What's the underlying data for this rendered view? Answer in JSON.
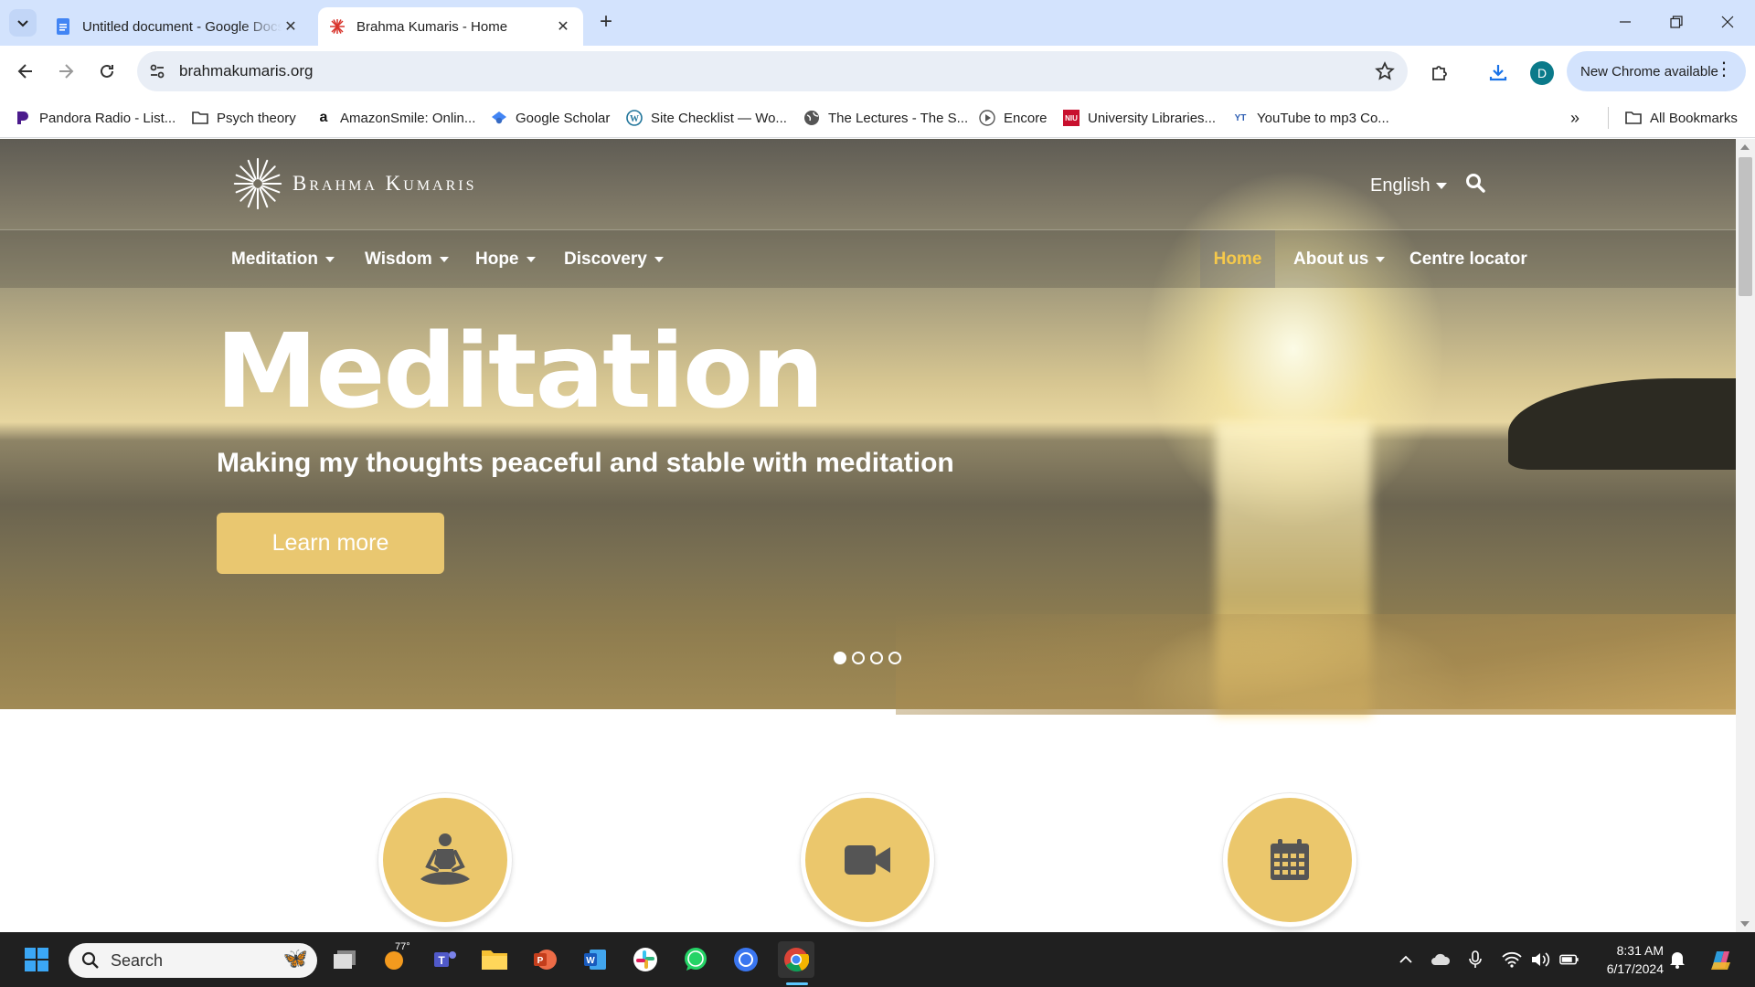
{
  "browser": {
    "tabs": [
      {
        "title": "Untitled document - Google Docs"
      },
      {
        "title": "Brahma Kumaris - Home"
      }
    ],
    "url": "brahmakumaris.org",
    "profile_initial": "D",
    "update_label": "New Chrome available"
  },
  "bookmarks": [
    {
      "label": "Pandora Radio - List..."
    },
    {
      "label": "Psych theory"
    },
    {
      "label": "AmazonSmile: Onlin..."
    },
    {
      "label": "Google Scholar"
    },
    {
      "label": "Site Checklist — Wo..."
    },
    {
      "label": "The Lectures - The S..."
    },
    {
      "label": "Encore"
    },
    {
      "label": "University Libraries..."
    },
    {
      "label": "YouTube to mp3 Co..."
    }
  ],
  "all_bookmarks_label": "All Bookmarks",
  "site": {
    "brand": "Brahma Kumaris",
    "language": "English",
    "nav_left": [
      {
        "label": "Meditation"
      },
      {
        "label": "Wisdom"
      },
      {
        "label": "Hope"
      },
      {
        "label": "Discovery"
      }
    ],
    "nav_right": [
      {
        "label": "Home"
      },
      {
        "label": "About us"
      },
      {
        "label": "Centre locator"
      }
    ],
    "hero": {
      "title": "Meditation",
      "subtitle": "Making my thoughts peaceful and stable with meditation",
      "cta": "Learn more",
      "slide_count": 4,
      "active_slide": 1
    },
    "features": [
      {
        "icon": "meditation-icon"
      },
      {
        "icon": "video-camera-icon"
      },
      {
        "icon": "calendar-icon"
      }
    ],
    "accent_color": "#e9c770"
  },
  "taskbar": {
    "search_placeholder": "Search",
    "weather_temp": "77°",
    "time": "8:31 AM",
    "date": "6/17/2024"
  }
}
